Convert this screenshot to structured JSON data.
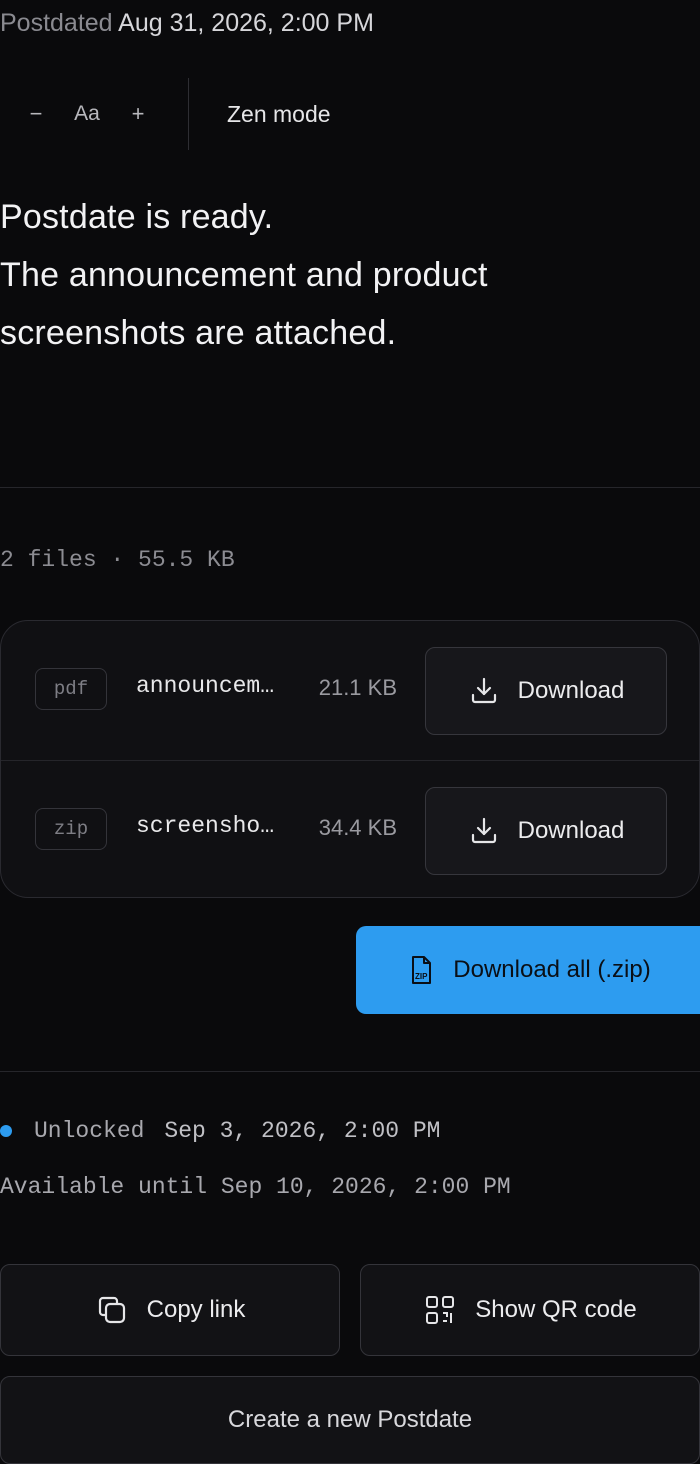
{
  "header": {
    "postdated_label": "Postdated",
    "postdated_value": "Aug 31, 2026, 2:00 PM"
  },
  "toolbar": {
    "decrease_label": "−",
    "font_label": "Aa",
    "increase_label": "+",
    "zen_label": "Zen mode"
  },
  "message": {
    "lines": [
      "Postdate is ready.",
      "The announcement and product",
      "screenshots are attached."
    ]
  },
  "files": {
    "summary": "2 files · 55.5 KB",
    "items": [
      {
        "ext": "pdf",
        "name": "announcement.pdf",
        "size": "21.1 KB",
        "action": "Download"
      },
      {
        "ext": "zip",
        "name": "screenshots.zip",
        "size": "34.4 KB",
        "action": "Download"
      }
    ],
    "download_all_label": "Download all (.zip)"
  },
  "status": {
    "unlocked_label": "Unlocked",
    "unlocked_time": "Sep 3, 2026, 2:00 PM",
    "available_text": "Available until Sep 10, 2026, 2:00 PM",
    "dot_color": "#2d9cf0"
  },
  "actions": {
    "copy_link": "Copy link",
    "show_qr": "Show QR code",
    "create_new": "Create a new Postdate"
  },
  "colors": {
    "accent": "#2d9cf0",
    "background": "#0a0a0c"
  }
}
